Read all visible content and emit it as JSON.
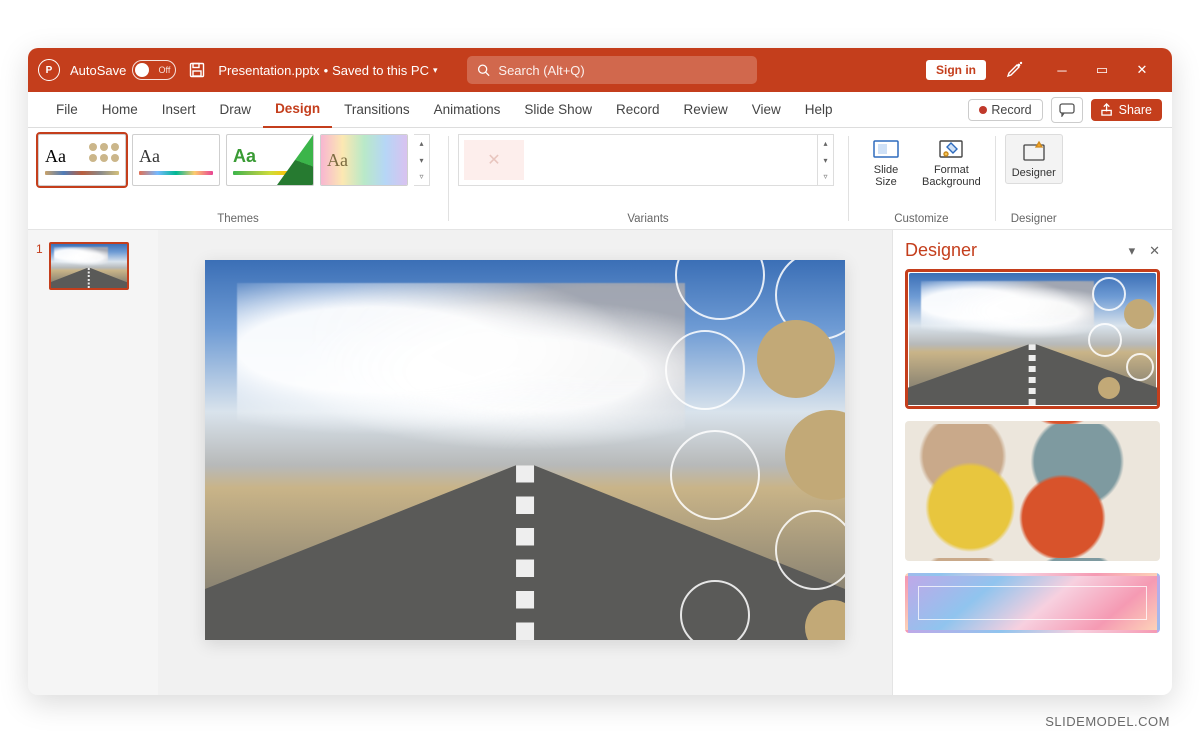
{
  "titlebar": {
    "app_badge": "P",
    "autosave_label": "AutoSave",
    "autosave_state": "Off",
    "filename": "Presentation.pptx",
    "save_status": "Saved to this PC",
    "search_placeholder": "Search (Alt+Q)",
    "signin_label": "Sign in"
  },
  "tabs": [
    "File",
    "Home",
    "Insert",
    "Draw",
    "Design",
    "Transitions",
    "Animations",
    "Slide Show",
    "Record",
    "Review",
    "View",
    "Help"
  ],
  "active_tab": "Design",
  "tabactions": {
    "record": "Record",
    "share": "Share"
  },
  "ribbon": {
    "themes_label": "Themes",
    "variants_label": "Variants",
    "customize_label": "Customize",
    "designer_label": "Designer",
    "slide_size": "Slide\nSize",
    "format_bg": "Format\nBackground",
    "designer_btn": "Designer"
  },
  "thumbs": {
    "slide1_number": "1"
  },
  "designer": {
    "title": "Designer"
  },
  "watermark": "SLIDEMODEL.COM"
}
